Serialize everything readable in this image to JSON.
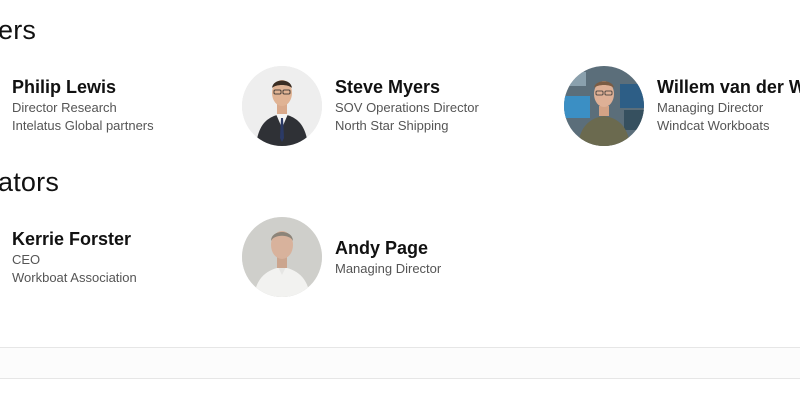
{
  "sections": [
    {
      "heading": "ers",
      "people": [
        {
          "name": "Philip Lewis",
          "title": "Director Research",
          "company": "Intelatus Global partners",
          "avatar_icon": "person-photo-icon"
        },
        {
          "name": "Steve Myers",
          "title": "SOV Operations Director",
          "company": "North Star Shipping",
          "avatar_icon": "person-photo-icon"
        },
        {
          "name": "Willem van der W",
          "title": "Managing Director",
          "company": "Windcat Workboats",
          "avatar_icon": "person-photo-icon"
        }
      ]
    },
    {
      "heading": "ators",
      "people": [
        {
          "name": "Kerrie Forster",
          "title": "CEO",
          "company": "Workboat Association",
          "avatar_icon": "person-photo-icon"
        },
        {
          "name": "Andy Page",
          "title": "Managing Director",
          "company": "",
          "avatar_icon": "person-photo-icon"
        }
      ]
    }
  ],
  "colors": {
    "text": "#111111",
    "muted": "#555555",
    "divider": "#e6e6e6"
  }
}
